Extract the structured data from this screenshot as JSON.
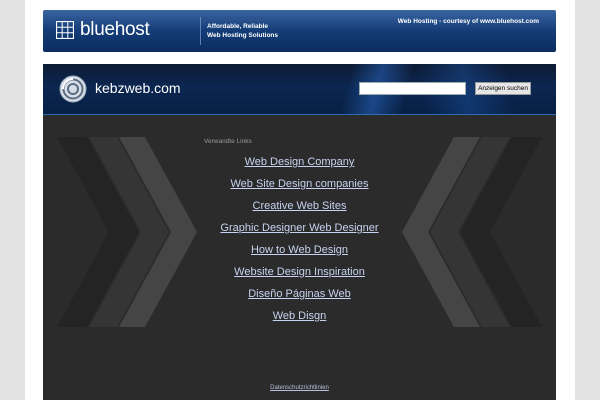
{
  "bluehost_banner": {
    "logo_text": "bluehost",
    "tagline_line1": "Affordable, Reliable",
    "tagline_line2": "Web Hosting Solutions",
    "right_text": "Web Hosting - courtesy of www.bluehost.com"
  },
  "header": {
    "site_name": "kebzweb.com",
    "search_placeholder": "",
    "search_button_label": "Anzeigen suchen"
  },
  "main": {
    "links_title": "Verwandte Links",
    "links": [
      "Web Design Company",
      "Web Site Design companies",
      "Creative Web Sites",
      "Graphic Designer Web Designer",
      "How to Web Design",
      "Website Design Inspiration",
      "Diseño Páginas Web",
      "Web Disgn"
    ],
    "footer_link": "Datenschutzrichtlinien"
  },
  "colors": {
    "banner_blue": "#123a74",
    "header_blue": "#0b2650",
    "main_bg": "#2b2b2b",
    "link_color": "#c7d3f0"
  }
}
